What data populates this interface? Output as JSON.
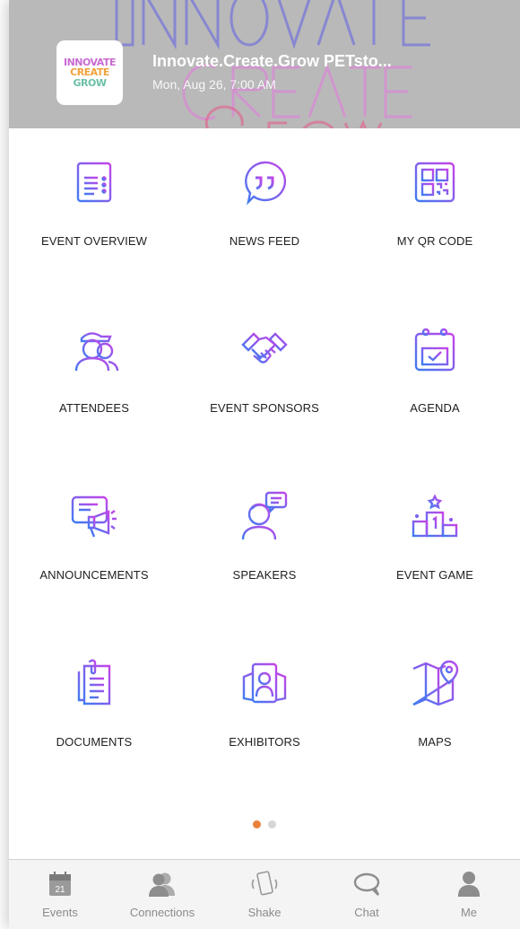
{
  "header": {
    "logo_lines": [
      "INNOVATE",
      "CREATE",
      "GROW"
    ],
    "event_title": "Innovate.Create.Grow PETsto...",
    "event_date": "Mon, Aug 26, 7:00 AM"
  },
  "grid": [
    {
      "label": "EVENT OVERVIEW",
      "icon": "event-overview-icon"
    },
    {
      "label": "NEWS FEED",
      "icon": "news-feed-icon"
    },
    {
      "label": "MY QR CODE",
      "icon": "qr-code-icon"
    },
    {
      "label": "ATTENDEES",
      "icon": "attendees-icon"
    },
    {
      "label": "EVENT SPONSORS",
      "icon": "handshake-icon"
    },
    {
      "label": "AGENDA",
      "icon": "calendar-icon"
    },
    {
      "label": "ANNOUNCEMENTS",
      "icon": "megaphone-icon"
    },
    {
      "label": "SPEAKERS",
      "icon": "speaker-icon"
    },
    {
      "label": "EVENT GAME",
      "icon": "podium-icon"
    },
    {
      "label": "DOCUMENTS",
      "icon": "documents-icon"
    },
    {
      "label": "EXHIBITORS",
      "icon": "exhibitors-icon"
    },
    {
      "label": "MAPS",
      "icon": "map-icon"
    }
  ],
  "pagination": {
    "pages": 2,
    "current": 1
  },
  "tabbar": [
    {
      "label": "Events",
      "icon": "calendar-day-icon",
      "day": "21"
    },
    {
      "label": "Connections",
      "icon": "people-icon"
    },
    {
      "label": "Shake",
      "icon": "phone-shake-icon"
    },
    {
      "label": "Chat",
      "icon": "chat-bubble-icon"
    },
    {
      "label": "Me",
      "icon": "person-icon"
    }
  ],
  "colors": {
    "icon_gradient_start": "#3f7cf2",
    "icon_gradient_end": "#c545e8",
    "active_dot": "#e8823c",
    "tab_text": "#8b8b8b"
  }
}
